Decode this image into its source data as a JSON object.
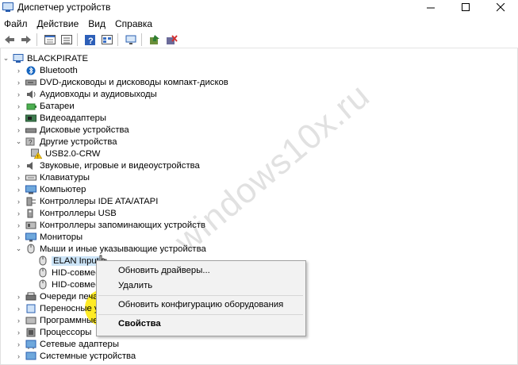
{
  "window": {
    "title": "Диспетчер устройств",
    "controls": [
      "minimize",
      "maximize",
      "close"
    ]
  },
  "menu": [
    "Файл",
    "Действие",
    "Вид",
    "Справка"
  ],
  "toolbar": [
    "back-icon",
    "forward-icon",
    "properties-icon",
    "list-icon",
    "help-icon",
    "view-icon",
    "monitor-icon",
    "update-driver-icon",
    "disable-icon"
  ],
  "tree": {
    "root": "BLACKPIRATE",
    "items": [
      "Bluetooth",
      "DVD-дисководы и дисководы компакт-дисков",
      "Аудиовходы и аудиовыходы",
      "Батареи",
      "Видеоадаптеры",
      "Дисковые устройства",
      "Другие устройства",
      "USB2.0-CRW",
      "Звуковые, игровые и видеоустройства",
      "Клавиатуры",
      "Компьютер",
      "Контроллеры IDE ATA/ATAPI",
      "Контроллеры USB",
      "Контроллеры запоминающих устройств",
      "Мониторы",
      "Мыши и иные указывающие устройства",
      "ELAN Input",
      "HID-совмес",
      "HID-совмес",
      "Очереди печат",
      "Переносные ус",
      "Программные",
      "Процессоры",
      "Сетевые адаптеры",
      "Системные устройства"
    ]
  },
  "context_menu": {
    "update_drivers": "Обновить драйверы...",
    "remove": "Удалить",
    "scan_hardware": "Обновить конфигурацию оборудования",
    "properties": "Свойства"
  },
  "watermark": "windows10x.ru"
}
